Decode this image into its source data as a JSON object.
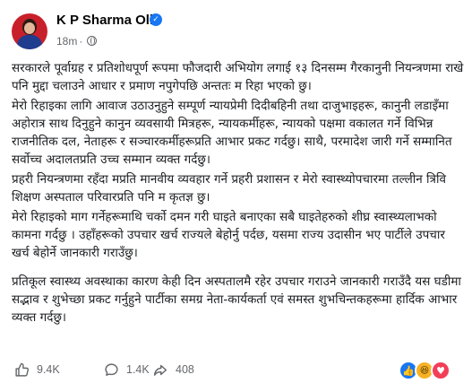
{
  "header": {
    "author": "K P Sharma Oli",
    "time": "18m",
    "separator": "·"
  },
  "post": {
    "paragraphs": [
      "सरकारले पूर्वाग्रह र प्रतिशोधपूर्ण रूपमा फौजदारी अभियोग लगाई १३ दिनसम्म गैरकानुनी नियन्त्रणमा राखे पनि मुद्दा चलाउने आधार र प्रमाण नपुगेपछि अन्ततः म रिहा भएको छु।",
      "मेरो रिहाइका लागि आवाज उठाउनुहुने सम्पूर्ण न्यायप्रेमी दिदीबहिनी तथा दाजुभाइहरू, कानुनी लडाइँमा अहोरात्र साथ दिनुहुने कानुन व्यवसायी मित्रहरू, न्यायकर्मीहरू, न्यायको पक्षमा वकालत गर्ने विभिन्न राजनीतिक दल, नेताहरू र सञ्चारकर्मीहरूप्रति आभार प्रकट गर्दछु। साथै, परमादेश जारी गर्ने सम्मानित सर्वोच्च अदालतप्रति उच्च सम्मान व्यक्त गर्दछु।",
      "प्रहरी नियन्त्रणमा रहँदा मप्रति मानवीय व्यवहार गर्ने प्रहरी प्रशासन र मेरो स्वास्थ्योपचारमा तल्लीन त्रिवि शिक्षण अस्पताल परिवारप्रति पनि म कृतज्ञ छु।",
      "मेरो रिहाइको माग गर्नेहरूमाथि चर्को दमन गरी घाइते बनाएका सबै घाइतेहरुको शीघ्र स्वास्थ्यलाभको कामना गर्दछु । उहाँहरूको उपचार खर्च राज्यले बेहोर्नु पर्दछ, यसमा राज्य उदासीन भए पार्टीले उपचार खर्च बेहोर्ने जानकारी गराउँछु।",
      "प्रतिकूल स्वास्थ्य अवस्थाका कारण केही दिन अस्पतालमै रहेर उपचार गराउने जानकारी गराउँदै यस घडीमा सद्भाव र शुभेच्छा प्रकट गर्नुहुने पार्टीका समग्र नेता-कार्यकर्ता एवं समस्त शुभचिन्तकहरूमा हार्दिक आभार व्यक्त गर्दछु।"
    ]
  },
  "footer": {
    "likes": "9.4K",
    "comments": "1.4K",
    "shares": "408"
  },
  "colors": {
    "accent": "#1877f2",
    "muted": "#65676b",
    "love": "#f33e58",
    "haha": "#f7b125"
  },
  "icons": {
    "verified": "verified-badge-icon",
    "audience": "globe-icon",
    "like": "like-icon",
    "comment": "comment-icon",
    "share": "share-icon"
  }
}
